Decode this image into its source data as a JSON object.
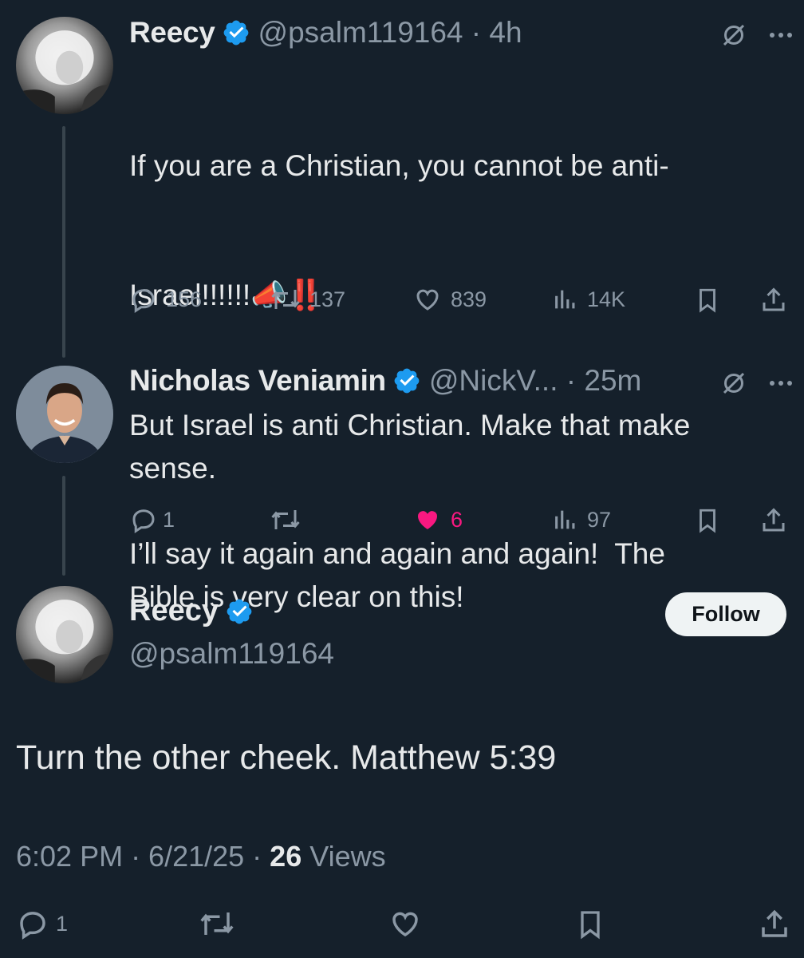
{
  "tweet1": {
    "name": "Reecy",
    "meta": "@psalm119164 · 4h",
    "text_line1": "If you are a Christian, you cannot be anti-",
    "text_line2": "Israel!!!!!!",
    "emoji_megaphone": "📣",
    "emoji_bang": "‼️",
    "text_rest": "I’ll say it again and again and again!  The\nBible is very clear on this!",
    "replies": "156",
    "reposts": "137",
    "likes": "839",
    "views": "14K"
  },
  "tweet2": {
    "name": "Nicholas Veniamin",
    "meta": "@NickV... · 25m",
    "text": "But Israel is anti Christian. Make that make\nsense.",
    "replies": "1",
    "reposts": "",
    "likes": "6",
    "views": "97"
  },
  "main": {
    "name": "Reecy",
    "handle": "@psalm119164",
    "follow_label": "Follow",
    "text": "Turn the other cheek. Matthew 5:39",
    "timestamp": "6:02 PM · 6/21/25 · ",
    "views_count": "26",
    "views_label": " Views",
    "replies": "1"
  },
  "colors": {
    "background": "#15202b",
    "verified": "#1d9bf0",
    "like_active": "#f91880",
    "muted": "#8b98a5"
  },
  "icons": [
    "verified-badge-icon",
    "grok-icon",
    "more-icon",
    "reply-icon",
    "repost-icon",
    "like-icon",
    "views-icon",
    "bookmark-icon",
    "share-icon"
  ]
}
